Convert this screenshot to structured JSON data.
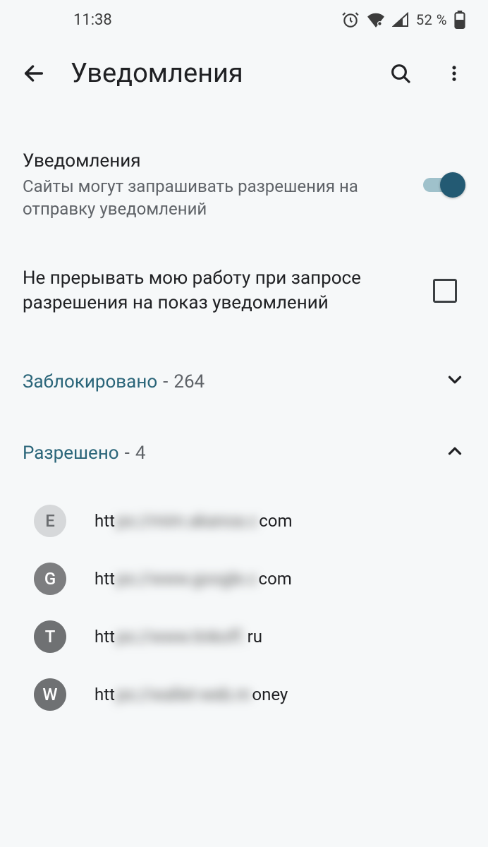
{
  "status": {
    "time": "11:38",
    "battery_text": "52 %"
  },
  "header": {
    "title": "Уведомления"
  },
  "settings": {
    "notif_title": "Уведомления",
    "notif_sub": "Сайты могут запрашивать разрешения на отправку уведомлений",
    "quiet_title": "Не прерывать мою работу при запросе разрешения на показ уведомлений"
  },
  "sections": {
    "blocked_label": "Заблокировано",
    "blocked_count": "264",
    "allowed_label": "Разрешено",
    "allowed_count": "4"
  },
  "sites": [
    {
      "letter": "E",
      "prefix": "htt",
      "mid": "ps://mim.akanoa.c",
      "suffix": "com",
      "avatar": "avatar-E"
    },
    {
      "letter": "G",
      "prefix": "htt",
      "mid": "ps://www.google.c",
      "suffix": "com",
      "avatar": "avatar-G"
    },
    {
      "letter": "T",
      "prefix": "htt",
      "mid": "ps://www.tinkoff.",
      "suffix": "ru",
      "avatar": "avatar-T"
    },
    {
      "letter": "W",
      "prefix": "htt",
      "mid": "ps://wallet-web.m",
      "suffix": "oney",
      "avatar": "avatar-W"
    }
  ]
}
